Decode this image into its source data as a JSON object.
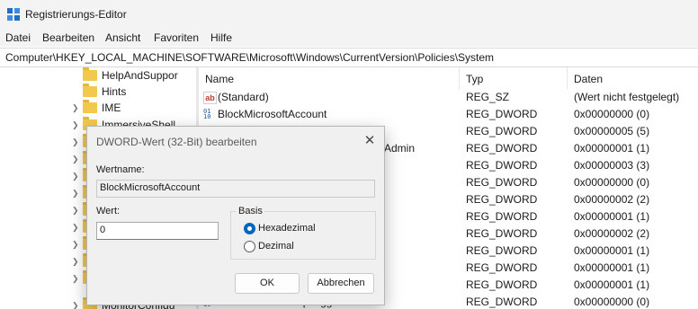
{
  "window": {
    "title": "Registrierungs-Editor"
  },
  "menu": [
    "Datei",
    "Bearbeiten",
    "Ansicht",
    "Favoriten",
    "Hilfe"
  ],
  "address": "Computer\\HKEY_LOCAL_MACHINE\\SOFTWARE\\Microsoft\\Windows\\CurrentVersion\\Policies\\System",
  "tree": {
    "items": [
      {
        "label": "HelpAndSuppor"
      },
      {
        "label": "Hints"
      },
      {
        "label": "IME"
      },
      {
        "label": "ImmersiveShell"
      },
      {
        "label": ""
      },
      {
        "label": ""
      },
      {
        "label": ""
      },
      {
        "label": ""
      },
      {
        "label": ""
      },
      {
        "label": ""
      },
      {
        "label": ""
      },
      {
        "label": ""
      },
      {
        "label": ""
      },
      {
        "label": "MonitorConfigu"
      }
    ]
  },
  "list": {
    "headers": {
      "name": "Name",
      "type": "Typ",
      "data": "Daten"
    },
    "rows": [
      {
        "name": "(Standard)",
        "type": "REG_SZ",
        "data": "(Wert nicht festgelegt)",
        "icon": "string-value-icon"
      },
      {
        "name": "BlockMicrosoftAccount",
        "type": "REG_DWORD",
        "data": "0x00000000 (0)",
        "icon": "binary-value-icon"
      },
      {
        "name": "",
        "type": "REG_DWORD",
        "data": "0x00000005 (5)",
        "icon": "binary-value-icon"
      },
      {
        "name": "Admin",
        "type": "REG_DWORD",
        "data": "0x00000001 (1)",
        "icon": "binary-value-icon"
      },
      {
        "name": "",
        "type": "REG_DWORD",
        "data": "0x00000003 (3)",
        "icon": "binary-value-icon"
      },
      {
        "name": "",
        "type": "REG_DWORD",
        "data": "0x00000000 (0)",
        "icon": "binary-value-icon"
      },
      {
        "name": "",
        "type": "REG_DWORD",
        "data": "0x00000002 (2)",
        "icon": "binary-value-icon"
      },
      {
        "name": "",
        "type": "REG_DWORD",
        "data": "0x00000001 (1)",
        "icon": "binary-value-icon"
      },
      {
        "name": "",
        "type": "REG_DWORD",
        "data": "0x00000002 (2)",
        "icon": "binary-value-icon"
      },
      {
        "name": "",
        "type": "REG_DWORD",
        "data": "0x00000001 (1)",
        "icon": "binary-value-icon"
      },
      {
        "name": "",
        "type": "REG_DWORD",
        "data": "0x00000001 (1)",
        "icon": "binary-value-icon"
      },
      {
        "name": "",
        "type": "REG_DWORD",
        "data": "0x00000001 (1)",
        "icon": "binary-value-icon"
      },
      {
        "name": "EnableUIADesktopToggle",
        "type": "REG_DWORD",
        "data": "0x00000000 (0)",
        "icon": "binary-value-icon"
      }
    ]
  },
  "dialog": {
    "title": "DWORD-Wert (32-Bit) bearbeiten",
    "name_label": "Wertname:",
    "name_value": "BlockMicrosoftAccount",
    "value_label": "Wert:",
    "value": "0",
    "basis_label": "Basis",
    "hex_label": "Hexadezimal",
    "dec_label": "Dezimal",
    "selected_basis": "Hexadezimal",
    "ok_label": "OK",
    "cancel_label": "Abbrechen"
  },
  "colors": {
    "accent": "#0067c0",
    "folder": "#f2c94c"
  }
}
